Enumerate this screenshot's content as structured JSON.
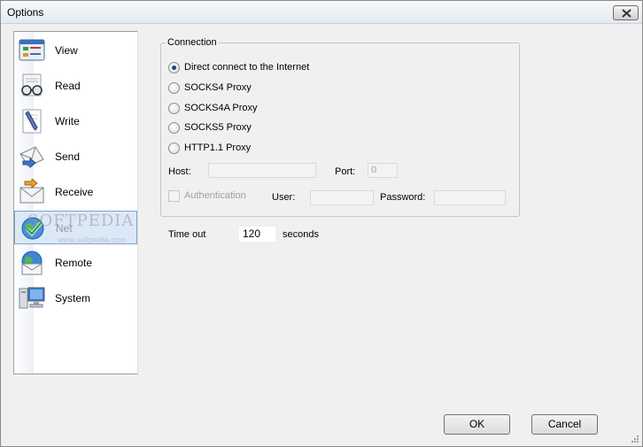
{
  "window": {
    "title": "Options"
  },
  "nav": {
    "items": [
      {
        "label": "View",
        "icon": "view-icon"
      },
      {
        "label": "Read",
        "icon": "glasses-icon"
      },
      {
        "label": "Write",
        "icon": "pen-icon"
      },
      {
        "label": "Send",
        "icon": "send-envelope-icon"
      },
      {
        "label": "Receive",
        "icon": "receive-envelope-icon"
      },
      {
        "label": "Net",
        "icon": "net-globe-icon",
        "selected": true
      },
      {
        "label": "Remote",
        "icon": "remote-globe-icon"
      },
      {
        "label": "System",
        "icon": "computer-icon"
      }
    ]
  },
  "watermark": {
    "text": "SOFTPEDIA",
    "sub": "www.softpedia.com"
  },
  "connection": {
    "legend": "Connection",
    "options": [
      {
        "label": "Direct connect to the Internet",
        "checked": true
      },
      {
        "label": "SOCKS4 Proxy",
        "checked": false
      },
      {
        "label": "SOCKS4A Proxy",
        "checked": false
      },
      {
        "label": "SOCKS5 Proxy",
        "checked": false
      },
      {
        "label": "HTTP1.1 Proxy",
        "checked": false
      }
    ],
    "host_label": "Host:",
    "host_value": "",
    "port_label": "Port:",
    "port_value": "0",
    "auth_label": "Authentication",
    "user_label": "User:",
    "user_value": "",
    "password_label": "Password:",
    "password_value": ""
  },
  "timeout": {
    "label": "Time out",
    "value": "120",
    "unit": "seconds"
  },
  "buttons": {
    "ok": "OK",
    "cancel": "Cancel"
  },
  "colors": {
    "selection": "#dbe8f7",
    "selection_border": "#7da2ce",
    "radio_dot": "#1b3f8b"
  }
}
